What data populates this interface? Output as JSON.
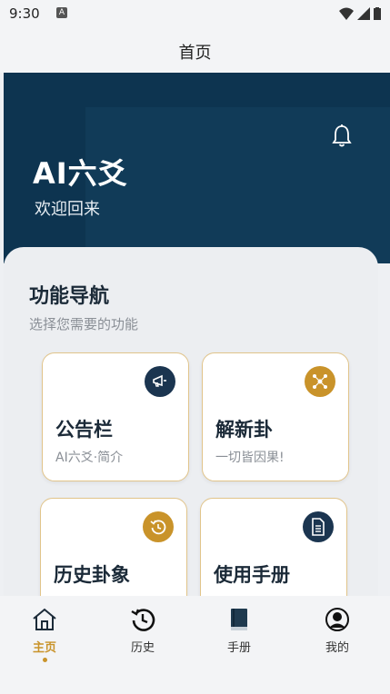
{
  "status": {
    "time": "9:30",
    "badge": "A"
  },
  "appbar": {
    "title": "首页"
  },
  "hero": {
    "app_name": "AI六爻",
    "welcome": "欢迎回来"
  },
  "section": {
    "title": "功能导航",
    "subtitle": "选择您需要的功能"
  },
  "cards": [
    {
      "title": "公告栏",
      "subtitle": "AI六爻·简介",
      "icon": "megaphone-icon",
      "icon_bg": "#1b3550"
    },
    {
      "title": "解新卦",
      "subtitle": "一切皆因果!",
      "icon": "network-icon",
      "icon_bg": "#c9932a"
    },
    {
      "title": "历史卦象",
      "subtitle": "",
      "icon": "history-icon",
      "icon_bg": "#c9932a"
    },
    {
      "title": "使用手册",
      "subtitle": "",
      "icon": "document-icon",
      "icon_bg": "#1b3550"
    }
  ],
  "nav": [
    {
      "label": "主页",
      "icon": "home-icon"
    },
    {
      "label": "历史",
      "icon": "history-icon"
    },
    {
      "label": "手册",
      "icon": "book-icon"
    },
    {
      "label": "我的",
      "icon": "profile-icon"
    }
  ],
  "colors": {
    "hero": "#0d3450",
    "accent": "#c9932a",
    "card_border": "#e1c48a"
  }
}
